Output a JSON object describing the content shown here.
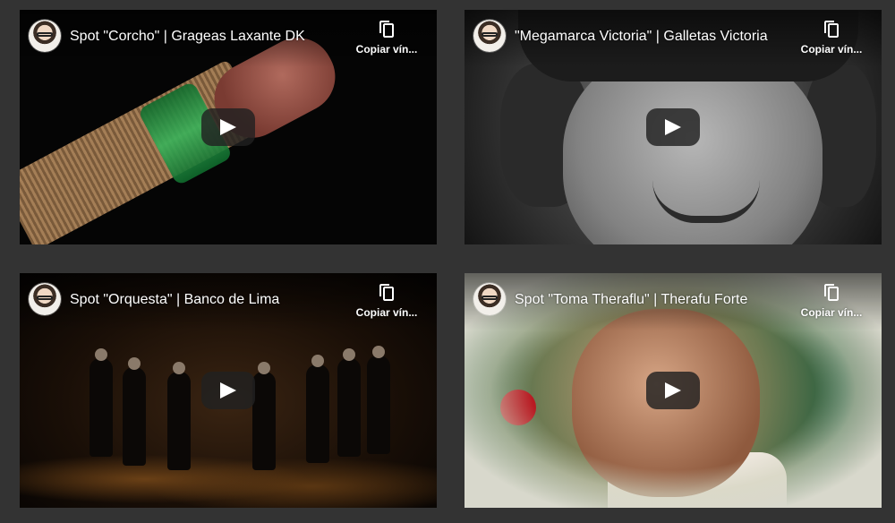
{
  "videos": [
    {
      "title": "Spot \"Corcho\" | Grageas Laxante DK",
      "copy_label": "Copiar vín..."
    },
    {
      "title": "\"Megamarca Victoria\" | Galletas Victoria",
      "copy_label": "Copiar vín..."
    },
    {
      "title": "Spot \"Orquesta\" | Banco de Lima",
      "copy_label": "Copiar vín..."
    },
    {
      "title": "Spot \"Toma Theraflu\" | Therafu Forte",
      "copy_label": "Copiar vín..."
    }
  ],
  "colors": {
    "page_background": "#333333",
    "play_button": "#212121"
  },
  "icons": {
    "copy": "copy-link-icon",
    "play": "play-icon"
  }
}
